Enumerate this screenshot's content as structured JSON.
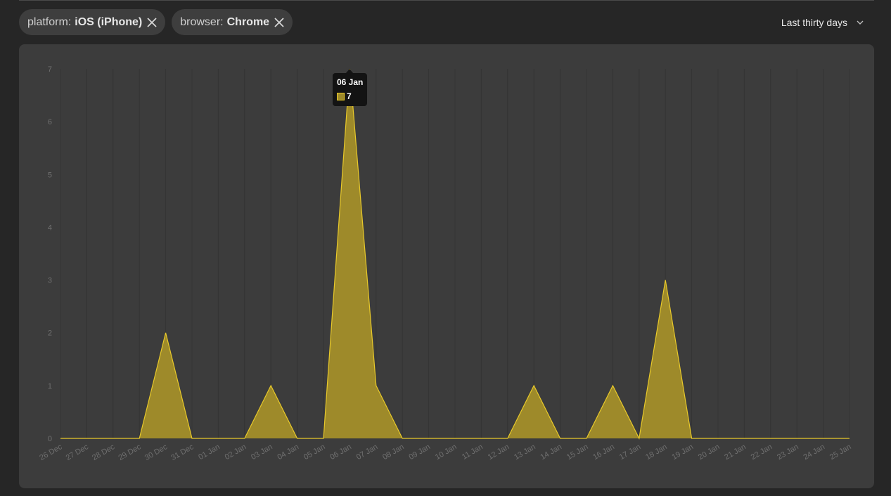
{
  "filters": [
    {
      "key": "platform:",
      "value": "iOS (iPhone)"
    },
    {
      "key": "browser:",
      "value": "Chrome"
    }
  ],
  "date_range": {
    "selected": "Last thirty days"
  },
  "tooltip": {
    "date": "06 Jan",
    "value": "7"
  },
  "colors": {
    "background": "#262626",
    "panel": "#3c3c3c",
    "series_fill": "#9e8a2a",
    "series_line": "#e8c92a",
    "grid": "#333333",
    "tick_text": "#6f6f6f"
  },
  "chart_data": {
    "type": "area",
    "x": [
      "26 Dec",
      "27 Dec",
      "28 Dec",
      "29 Dec",
      "30 Dec",
      "31 Dec",
      "01 Jan",
      "02 Jan",
      "03 Jan",
      "04 Jan",
      "05 Jan",
      "06 Jan",
      "07 Jan",
      "08 Jan",
      "09 Jan",
      "10 Jan",
      "11 Jan",
      "12 Jan",
      "13 Jan",
      "14 Jan",
      "15 Jan",
      "16 Jan",
      "17 Jan",
      "18 Jan",
      "19 Jan",
      "20 Jan",
      "21 Jan",
      "22 Jan",
      "23 Jan",
      "24 Jan",
      "25 Jan"
    ],
    "series": [
      {
        "values": [
          0,
          0,
          0,
          0,
          2,
          0,
          0,
          0,
          1,
          0,
          0,
          7,
          1,
          0,
          0,
          0,
          0,
          0,
          1,
          0,
          0,
          1,
          0,
          3,
          0,
          0,
          0,
          0,
          0,
          0,
          0
        ]
      }
    ],
    "yticks": [
      0,
      1,
      2,
      3,
      4,
      5,
      6,
      7
    ],
    "ylim": [
      0,
      7
    ],
    "grid": "vertical"
  }
}
